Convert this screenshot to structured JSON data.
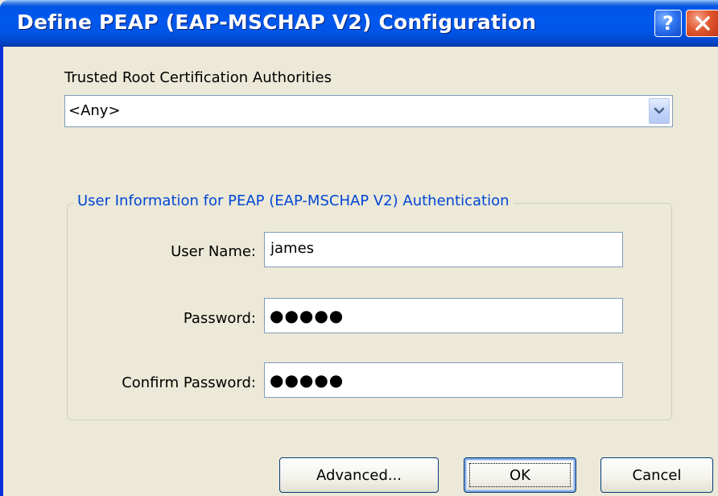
{
  "window": {
    "title": "Define PEAP (EAP-MSCHAP V2) Configuration",
    "help_label": "?"
  },
  "trusted_root": {
    "label": "Trusted Root Certification Authorities",
    "selected": "<Any>"
  },
  "user_info": {
    "group_title": "User Information for PEAP (EAP-MSCHAP V2) Authentication",
    "username_label": "User Name:",
    "username_value": "james",
    "password_label": "Password:",
    "password_masked": "●●●●●",
    "confirm_label": "Confirm Password:",
    "confirm_masked": "●●●●●"
  },
  "buttons": {
    "advanced": "Advanced...",
    "ok": "OK",
    "cancel": "Cancel"
  },
  "colors": {
    "titlebar": "#0058ee",
    "dialog_bg": "#ece9d8",
    "group_title": "#0046d5",
    "close_button": "#e0582f"
  },
  "icons": {
    "help": "question-mark-icon",
    "close": "close-x-icon",
    "dropdown": "chevron-down-icon"
  }
}
